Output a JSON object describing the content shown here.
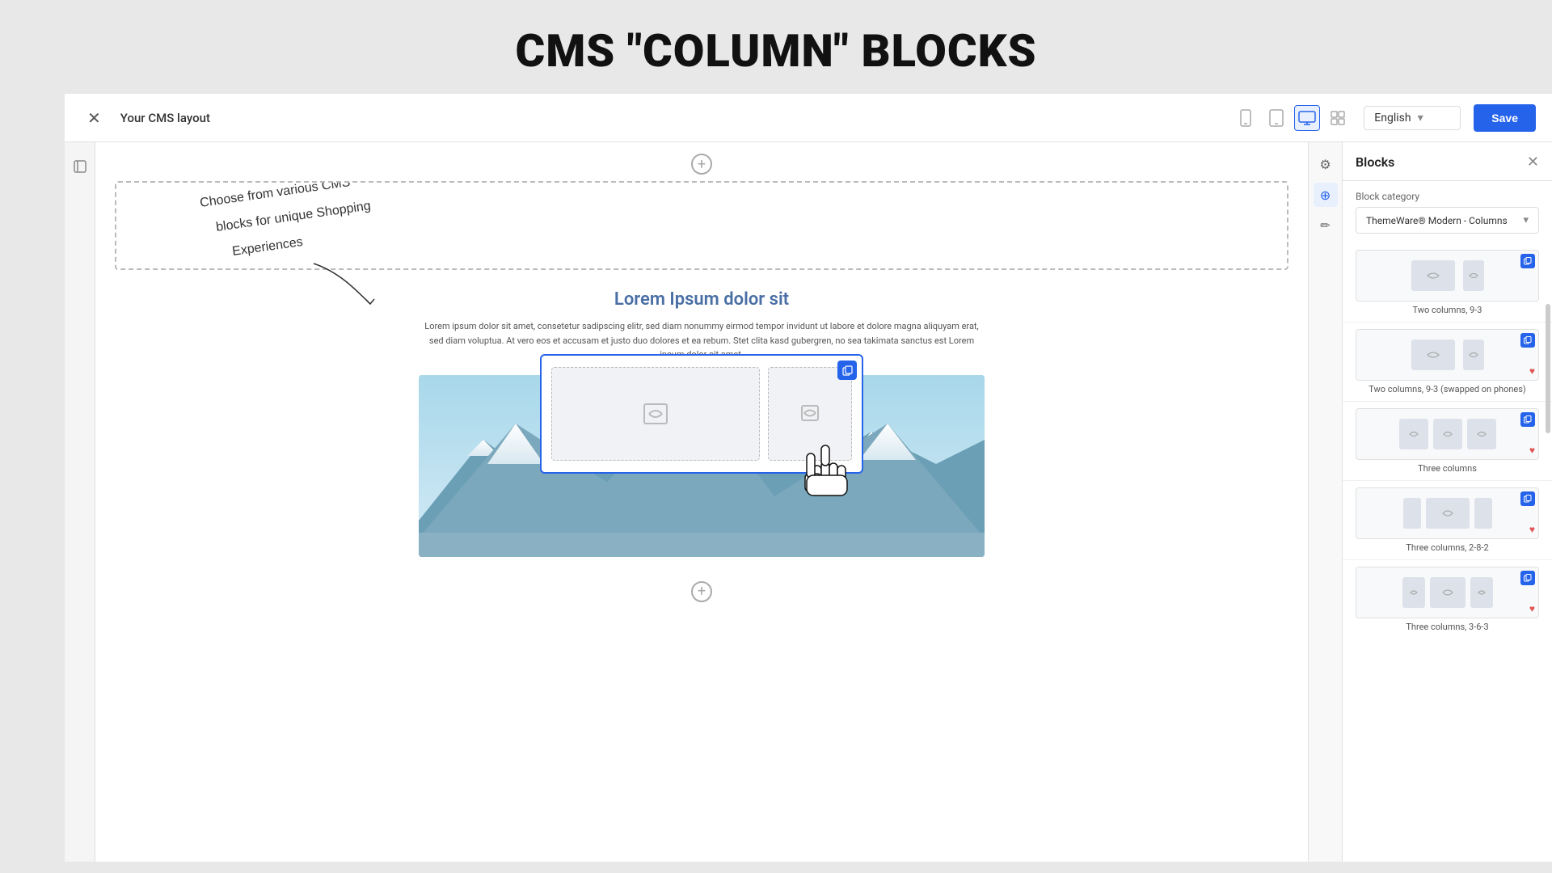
{
  "page": {
    "title": "CMS \"COLUMN\" BLOCKS"
  },
  "topbar": {
    "title": "Your CMS layout",
    "close_label": "×",
    "language": "English",
    "save_label": "Save",
    "device_icons": [
      "mobile",
      "tablet",
      "desktop",
      "grid"
    ]
  },
  "sidebar": {
    "icons": [
      "refresh",
      "layers",
      "package",
      "users",
      "chart",
      "megaphone",
      "shield",
      "settings",
      "plus-circle",
      "table",
      "table2",
      "table3",
      "table4",
      "table5",
      "table6",
      "more"
    ]
  },
  "canvas": {
    "add_block_label": "+",
    "section_title": "Lorem Ipsum dolor sit",
    "section_body": "Lorem ipsum dolor sit amet, consetetur sadipscing elitr, sed diam nonummy eirmod tempor invidunt ut labore et dolore magna aliquyam erat, sed diam voluptua. At vero eos et accusam et justo duo dolores et ea rebum. Stet clita kasd gubergren, no sea takimata sanctus est Lorem ipsum dolor sit amet."
  },
  "annotation": {
    "text": "Choose from various CMS blocks for unique Shopping Experiences"
  },
  "blocks_panel": {
    "title": "Blocks",
    "close_label": "×",
    "category_label": "Block category",
    "category_value": "ThemeWare® Modern - Columns",
    "items": [
      {
        "name": "Two columns, 9-3",
        "columns": [
          "lg",
          "sm"
        ],
        "has_copy": true,
        "has_heart": false
      },
      {
        "name": "Two columns, 9-3 (swapped on phones)",
        "columns": [
          "lg",
          "sm"
        ],
        "has_copy": true,
        "has_heart": true
      },
      {
        "name": "Three columns",
        "columns": [
          "md",
          "md",
          "md"
        ],
        "has_copy": true,
        "has_heart": true
      },
      {
        "name": "Three columns, 2-8-2",
        "columns": [
          "sm",
          "lg2",
          "sm"
        ],
        "has_copy": true,
        "has_heart": true
      },
      {
        "name": "Three columns, 3-6-3",
        "columns": [
          "sm",
          "lg",
          "sm"
        ],
        "has_copy": true,
        "has_heart": true
      }
    ]
  }
}
